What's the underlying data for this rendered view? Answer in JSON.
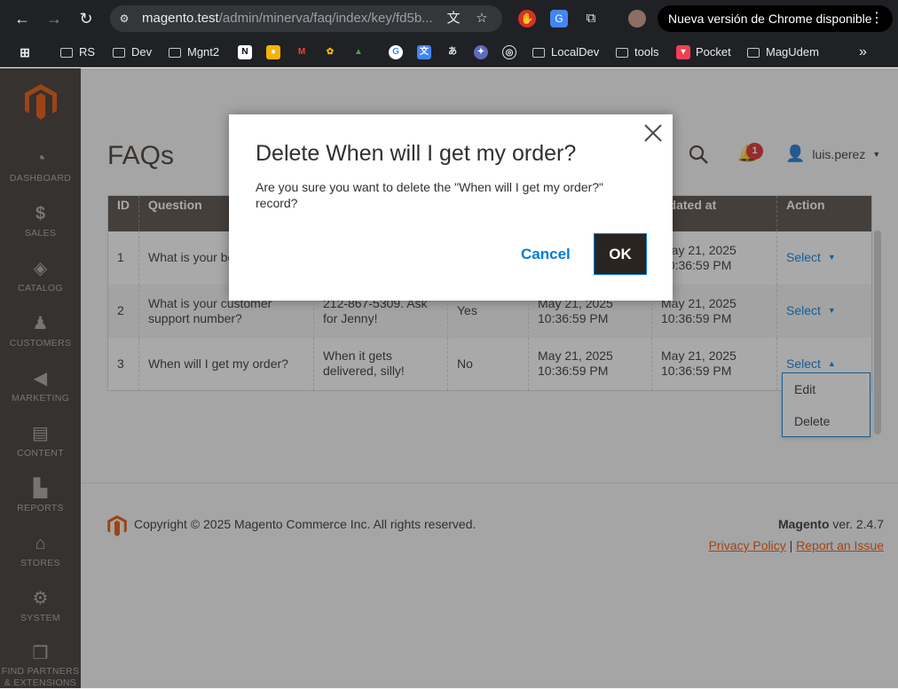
{
  "browser": {
    "url_host": "magento.test",
    "url_path": "/admin/minerva/faq/index/key/fd5b...",
    "update_pill": "Nueva versión de Chrome disponible",
    "bookmarks": [
      "RS",
      "Dev",
      "Mgnt2",
      "LocalDev",
      "tools",
      "Pocket",
      "MagUdem"
    ]
  },
  "sidebar": {
    "items": [
      {
        "label": "DASHBOARD",
        "icon": "dashboard-icon"
      },
      {
        "label": "SALES",
        "icon": "dollar-icon"
      },
      {
        "label": "CATALOG",
        "icon": "box-icon"
      },
      {
        "label": "CUSTOMERS",
        "icon": "person-icon"
      },
      {
        "label": "MARKETING",
        "icon": "megaphone-icon"
      },
      {
        "label": "CONTENT",
        "icon": "layout-icon"
      },
      {
        "label": "REPORTS",
        "icon": "bar-chart-icon"
      },
      {
        "label": "STORES",
        "icon": "store-icon"
      },
      {
        "label": "SYSTEM",
        "icon": "gear-icon"
      },
      {
        "label": "FIND PARTNERS & EXTENSIONS",
        "icon": "cubes-icon"
      }
    ]
  },
  "header": {
    "page_title": "FAQs",
    "notification_count": "1",
    "username": "luis.perez"
  },
  "grid": {
    "columns": [
      "ID",
      "Question",
      "",
      "",
      "",
      "pdated at",
      "Action"
    ],
    "rows": [
      {
        "id": "1",
        "question": "What is your be item?",
        "answer": "",
        "active": "",
        "created": "",
        "updated": "May 21, 2025 10:36:59 PM",
        "action": "Select"
      },
      {
        "id": "2",
        "question": "What is your customer support number?",
        "answer": "212-867-5309. Ask for Jenny!",
        "active": "Yes",
        "created": "May 21, 2025 10:36:59 PM",
        "updated": "May 21, 2025 10:36:59 PM",
        "action": "Select"
      },
      {
        "id": "3",
        "question": "When will I get my order?",
        "answer": "When it gets delivered, silly!",
        "active": "No",
        "created": "May 21, 2025 10:36:59 PM",
        "updated": "May 21, 2025 10:36:59 PM",
        "action": "Select"
      }
    ],
    "dropdown_options": [
      "Edit",
      "Delete"
    ]
  },
  "footer": {
    "copyright": "Copyright © 2025 Magento Commerce Inc. All rights reserved.",
    "brand": "Magento",
    "version": "ver. 2.4.7",
    "privacy": "Privacy Policy",
    "separator": "|",
    "report": "Report an Issue"
  },
  "modal": {
    "title": "Delete When will I get my order?",
    "body": "Are you sure you want to delete the \"When will I get my order?\" record?",
    "cancel": "Cancel",
    "ok": "OK"
  }
}
